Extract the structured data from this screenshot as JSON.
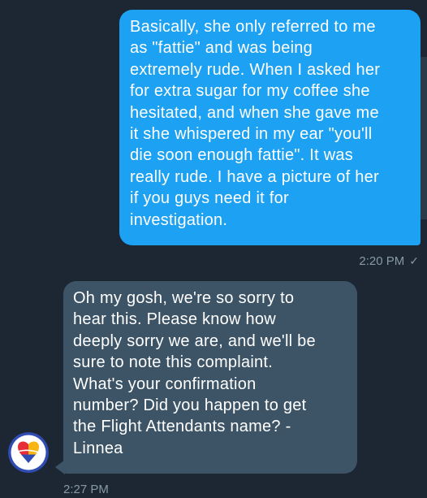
{
  "conversation": {
    "outgoing_message": {
      "text": "Basically, she only referred to me\nas \"fattie\" and was being\nextremely rude. When I asked her\nfor extra sugar for my coffee she\nhesitated, and when she gave me\nit she whispered in my ear \"you'll\ndie soon enough fattie\". It was\nreally rude. I have a picture of her\nif you guys need it for\ninvestigation.",
      "timestamp": "2:20 PM",
      "status_icon": "checkmark-icon"
    },
    "incoming_message": {
      "text": "Oh my gosh, we're so sorry to\nhear this. Please know how\ndeeply sorry we are, and we'll be\nsure to note this complaint.\nWhat's your confirmation\nnumber? Did you happen to get\nthe Flight Attendants name? -\nLinnea",
      "timestamp": "2:27 PM",
      "avatar_icon": "southwest-heart-logo-icon"
    }
  },
  "colors": {
    "background": "#1c2733",
    "outgoing_bubble": "#1da1f2",
    "incoming_bubble": "#3d5466",
    "timestamp": "#8899a6",
    "text": "#ffffff",
    "avatar_ring": "#304cb2",
    "heart_red": "#e62e38",
    "heart_yellow": "#f9b612",
    "heart_blue": "#304cb2"
  }
}
